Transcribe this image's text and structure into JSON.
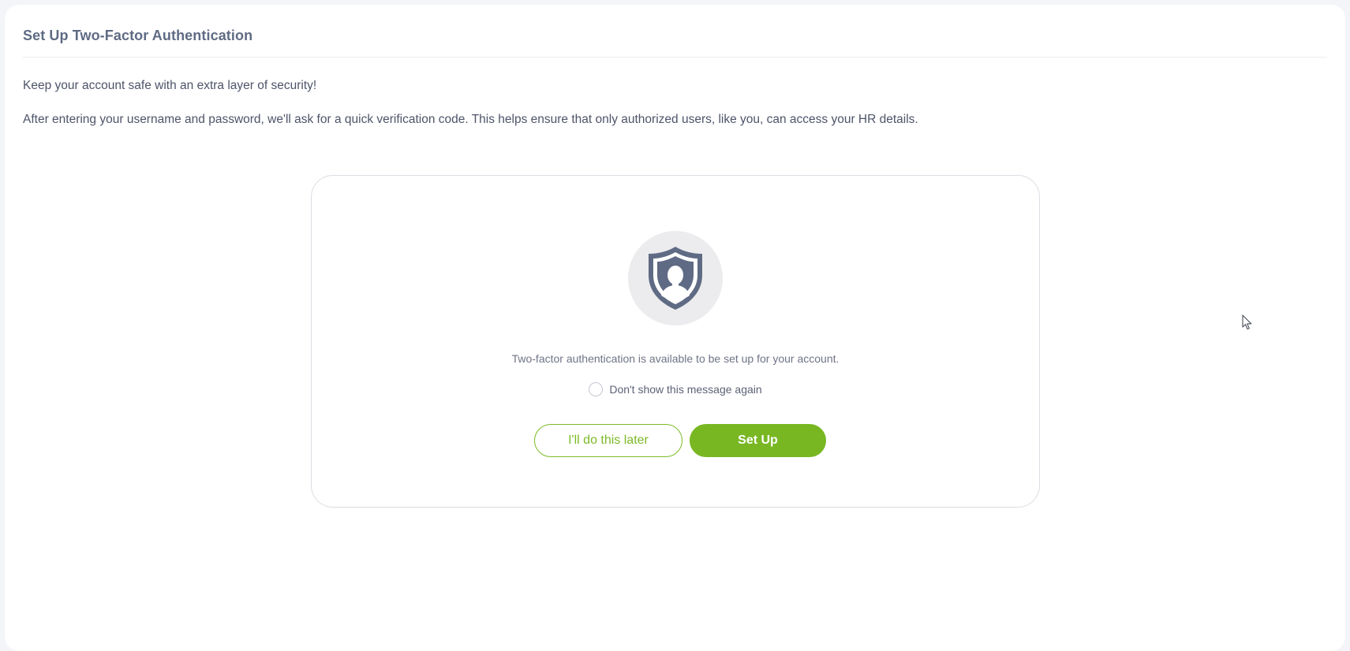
{
  "header": {
    "title": "Set Up Two-Factor Authentication"
  },
  "intro": {
    "line1": "Keep your account safe with an extra layer of security!",
    "line2": "After entering your username and password, we'll ask for a quick verification code. This helps ensure that only authorized users, like you, can access your HR details."
  },
  "setup_card": {
    "icon": "shield-user-icon",
    "status_message": "Two-factor authentication is available to be set up for your account.",
    "dont_show_again": {
      "label": "Don't show this message again",
      "checked": false
    },
    "later_button": "I'll do this later",
    "setup_button": "Set Up"
  },
  "colors": {
    "accent": "#78b722",
    "title": "#5f6b84",
    "icon": "#5f6b84",
    "icon_bg": "#ececee"
  }
}
